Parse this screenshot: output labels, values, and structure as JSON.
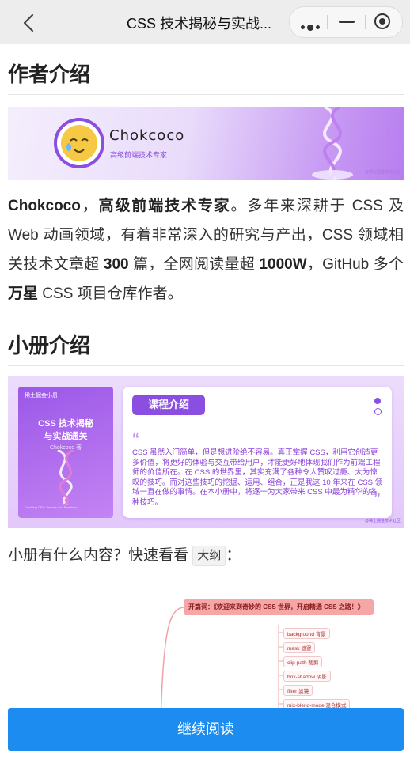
{
  "topbar": {
    "title": "CSS 技术揭秘与实战...",
    "back_icon": "chevron-left-icon",
    "menu_icons": [
      "more-dots-icon",
      "minimize-icon",
      "target-icon"
    ]
  },
  "section_author": {
    "heading": "作者介绍",
    "banner": {
      "name": "Chokcoco",
      "subtitle": "高级前端技术专家",
      "credit": "@稀土掘金技术社区"
    },
    "bio": {
      "p1_name": "Chokcoco",
      "p1_sep": "，",
      "p1_role": "高级前端技术专家",
      "p1_rest": "。多年来深耕于 CSS 及 Web 动画领域，有着非常深入的研究与产出，CSS 领域相关技术文章超 ",
      "p1_count": "300",
      "p1_rest2": " 篇，全网阅读量超 ",
      "p1_reads": "1000W",
      "p1_rest3": "，GitHub 多个",
      "p1_star": "万星",
      "p1_rest4": " CSS 项目仓库作者。"
    }
  },
  "section_book": {
    "heading": "小册介绍",
    "banner": {
      "brand": "稀土掘金小册",
      "cover_title_1": "CSS 技术揭秘",
      "cover_title_2": "与实战通关",
      "cover_author": "Chokcoco 著",
      "cover_footer": "Cracking CSS: Secrets and Practices",
      "card_tab": "课程介绍",
      "quote_open": "“",
      "quote_close": "”",
      "card_text": "CSS 虽然入门简单，但是想进阶绝不容易。真正掌握 CSS，利用它创造更多价值，将更好的体验与交互带给用户，才能更好地体现我们作为前端工程师的价值所在。在 CSS 的世界里，其实充满了各种令人赞叹过瘾、大为惊叹的技巧。而对这些技巧的挖掘、运用、组合，正是我这 10 年来在 CSS 领域一直在做的事情。在本小册中，将逐一为大家带来 CSS 中最为精华的各种技巧。",
      "credit": "@稀土掘金技术社区"
    },
    "question": "小册有什么内容？快速看看",
    "question_tag": "大纲",
    "question_end": "："
  },
  "mindmap": {
    "root": "开篇词：《欢迎来到奇妙的 CSS 世界，开启精通 CSS 之路！》",
    "nodes": [
      "background 背景",
      "mask 遮罩",
      "clip-path 裁剪",
      "box-shadow 阴影",
      "filter 滤镜",
      "mix-blend-mode 混合模式"
    ]
  },
  "cta": {
    "label": "继续阅读"
  },
  "colors": {
    "accent": "#1d8cf0",
    "purple": "#8a4fe0"
  }
}
